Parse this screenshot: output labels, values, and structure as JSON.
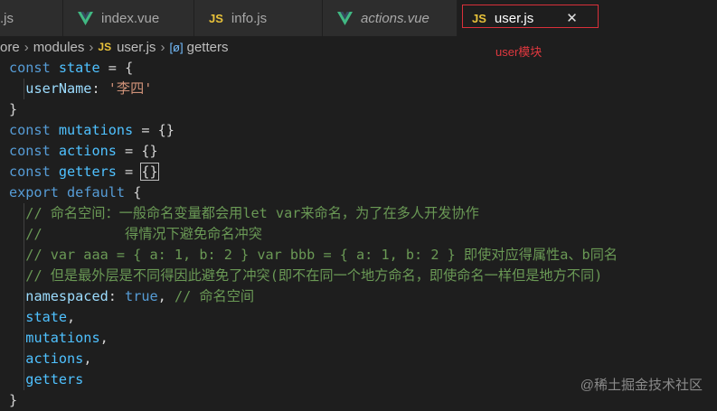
{
  "tabs": [
    {
      "label": ".js",
      "icon": "js-icon",
      "icon_text": "",
      "active": false,
      "italic": false
    },
    {
      "label": "index.vue",
      "icon": "vue-icon",
      "active": false,
      "italic": false
    },
    {
      "label": "info.js",
      "icon": "js-icon",
      "icon_text": "JS",
      "active": false,
      "italic": false
    },
    {
      "label": "actions.vue",
      "icon": "vue-icon",
      "active": false,
      "italic": true
    },
    {
      "label": "user.js",
      "icon": "js-icon",
      "icon_text": "JS",
      "active": true,
      "italic": false,
      "close_label": "✕"
    }
  ],
  "annotation": "user模块",
  "breadcrumb": {
    "seg0": "ore",
    "seg1": "modules",
    "seg2_icon": "JS",
    "seg2": "user.js",
    "seg3_icon": "[ø]",
    "seg3": "getters"
  },
  "code": [
    "const state = {",
    "  userName: '李四'",
    "}",
    "const mutations = {}",
    "const actions = {}",
    "const getters = {}",
    "export default {",
    "  // 命名空间：一般命名变量都会用let var来命名，为了在多人开发协作",
    "  //          得情况下避免命名冲突",
    "  // var aaa = { a: 1, b: 2 } var bbb = { a: 1, b: 2 } 即使对应得属性a、b同名",
    "  // 但是最外层是不同得因此避免了冲突(即不在同一个地方命名，即使命名一样但是地方不同)",
    "  namespaced: true, // 命名空间",
    "  state,",
    "  mutations,",
    "  actions,",
    "  getters",
    "}"
  ],
  "watermark": "@稀土掘金技术社区",
  "colors": {
    "keyword": "#569cd6",
    "variable": "#4fc1ff",
    "property": "#9cdcfe",
    "string": "#ce9178",
    "comment": "#6a9955",
    "highlight_box": "#d9303a",
    "annotation": "#e0383f",
    "js_icon": "#e8c23a",
    "vue_icon": "#41b883"
  }
}
